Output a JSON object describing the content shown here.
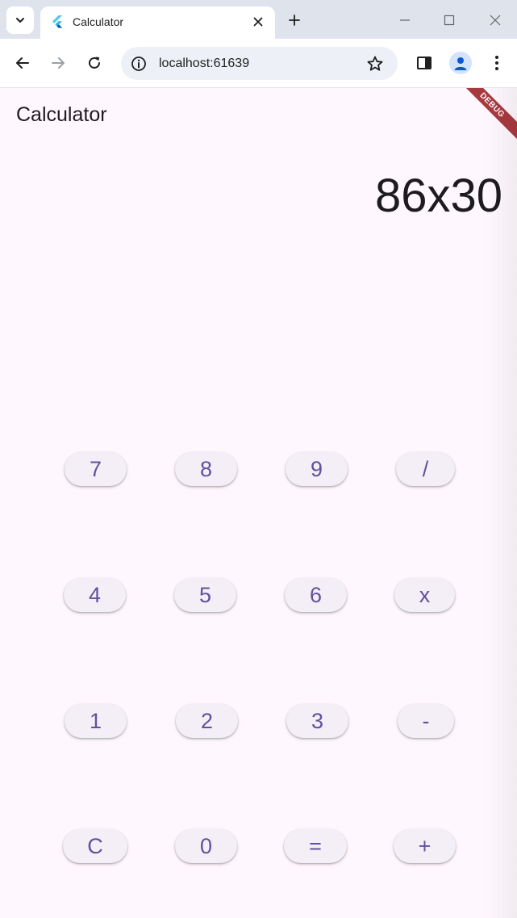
{
  "browser": {
    "tab": {
      "title": "Calculator"
    },
    "omnibox": {
      "url": "localhost:61639"
    },
    "icons": {
      "tab_search": "chevron-down-icon",
      "favicon": "flutter-logo-icon",
      "tab_close": "close-icon",
      "new_tab": "plus-icon",
      "minimize": "minimize-icon",
      "maximize": "maximize-icon",
      "close_window": "close-icon",
      "back": "arrow-left-icon",
      "forward": "arrow-right-icon",
      "reload": "reload-icon",
      "site_info": "info-icon",
      "bookmark": "star-icon",
      "side_panel": "side-panel-icon",
      "profile": "person-icon",
      "menu": "more-vertical-icon"
    }
  },
  "app": {
    "title": "Calculator",
    "debug_banner": "DEBUG",
    "display": "86x30",
    "keys": {
      "k7": "7",
      "k8": "8",
      "k9": "9",
      "divide": "/",
      "k4": "4",
      "k5": "5",
      "k6": "6",
      "multiply": "x",
      "k1": "1",
      "k2": "2",
      "k3": "3",
      "subtract": "-",
      "clear": "C",
      "k0": "0",
      "equals": "=",
      "add": "+"
    }
  },
  "colors": {
    "app_background": "#fef7fd",
    "key_background": "#f4eff6",
    "key_text": "#62509c",
    "text_primary": "#1d1b20",
    "debug_banner": "#a8393f",
    "browser_frame": "#dfe3eb",
    "omnibox": "#edf0f7"
  }
}
